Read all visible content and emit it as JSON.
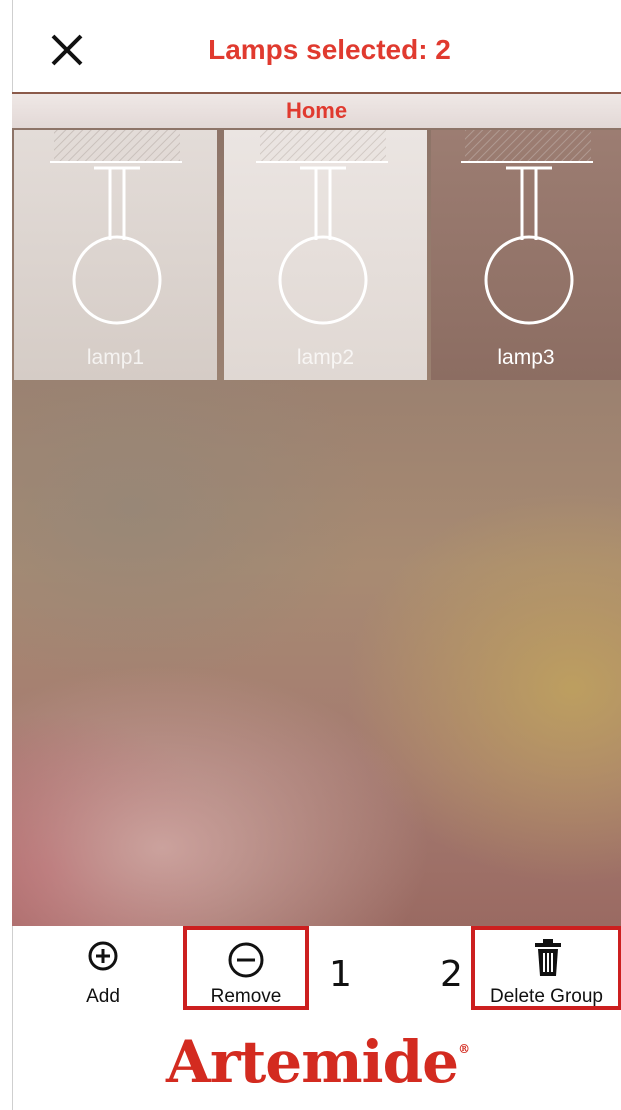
{
  "header": {
    "title": "Lamps selected: 2",
    "close_icon": "close-icon",
    "subtitle": "Home"
  },
  "lamps": [
    {
      "label": "lamp1",
      "selected": true
    },
    {
      "label": "lamp2",
      "selected": true
    },
    {
      "label": "lamp3",
      "selected": false
    }
  ],
  "toolbar": {
    "add": {
      "label": "Add",
      "icon": "plus-circle-icon"
    },
    "remove": {
      "label": "Remove",
      "icon": "minus-circle-icon"
    },
    "delete_group": {
      "label": "Delete Group",
      "icon": "trash-icon"
    },
    "annotation_1": "1",
    "annotation_2": "2"
  },
  "brand": {
    "logo_text": "Artemide",
    "registered_mark": "®",
    "color": "#d32b20"
  },
  "colors": {
    "accent": "#e03a2f",
    "highlight_box": "#cc1f1f"
  }
}
